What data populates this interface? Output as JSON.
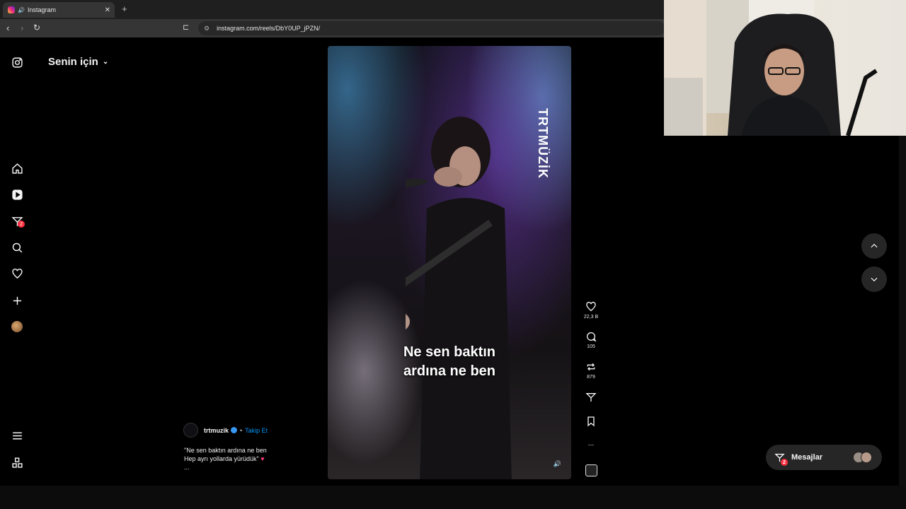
{
  "browser": {
    "tab_title": "Instagram",
    "tab_close": "✕",
    "new_tab": "+",
    "url": "instagram.com/reels/DbY0UP_jPZN/"
  },
  "sidebar": {
    "notifications_badge": "2",
    "menu_icons": [
      "instagram-logo-icon",
      "home-icon",
      "reels-icon",
      "messenger-icon",
      "search-icon",
      "heart-icon",
      "create-icon",
      "profile-avatar",
      "menu-icon",
      "apps-icon"
    ]
  },
  "feed": {
    "title": "Senin için"
  },
  "video": {
    "watermark": "TRTMÜZİK",
    "caption_line1": "Ne sen baktın",
    "caption_line2": "ardına ne ben"
  },
  "actions": {
    "likes": "22,3 B",
    "comments": "105",
    "reposts": "879",
    "more": "..."
  },
  "post": {
    "author": "trtmuzik",
    "separator": "•",
    "follow_label": "Takip Et",
    "desc_line1": "\"Ne sen baktın ardına ne ben",
    "desc_line2": "Hep ayrı yollarda yürüdük\"",
    "desc_more": "..."
  },
  "messages": {
    "label": "Mesajlar",
    "badge": "2"
  },
  "colors": {
    "accent_blue": "#0095f6",
    "badge_red": "#ff3040",
    "background": "#000000"
  }
}
